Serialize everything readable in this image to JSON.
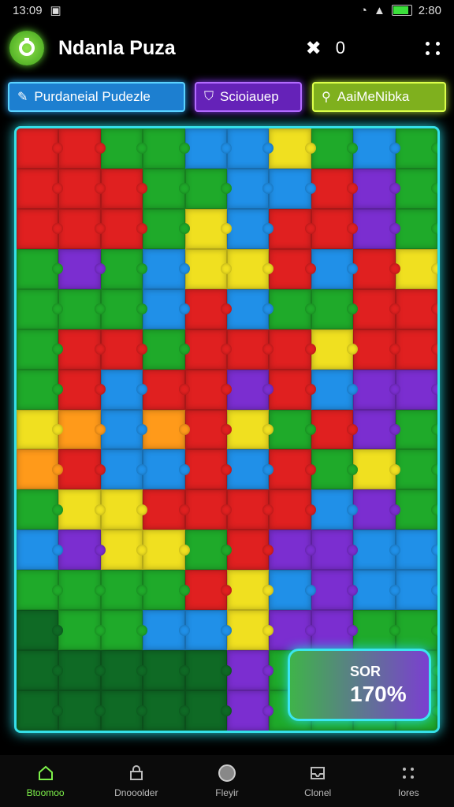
{
  "status": {
    "time": "13:09",
    "battery": "2:80",
    "battery_level": 0.8
  },
  "app": {
    "title": "Ndanla Puza",
    "close_label": "✖",
    "score_top": "0"
  },
  "tabs": [
    {
      "label": "Purdaneial Pudezle",
      "icon": "puzzle-icon"
    },
    {
      "label": "Scioiauep",
      "icon": "tag-icon"
    },
    {
      "label": "AaiMeNibka",
      "icon": "search-icon"
    }
  ],
  "score": {
    "label": "SOR",
    "value": "170%"
  },
  "nav": [
    {
      "label": "Btoomoo",
      "icon": "home-icon"
    },
    {
      "label": "Dnooolder",
      "icon": "lock-icon"
    },
    {
      "label": "Fleyir",
      "icon": "circle-icon"
    },
    {
      "label": "Clonel",
      "icon": "inbox-icon"
    },
    {
      "label": "Iores",
      "icon": "dots-icon"
    }
  ],
  "colors": {
    "red": "#e02020",
    "green": "#1faa2a",
    "blue": "#2090e8",
    "yellow": "#f0e020",
    "purple": "#7b2ed0",
    "orange": "#ff9a1a",
    "darkgreen": "#0f6a25"
  },
  "pieces": [
    "red",
    "red",
    "green",
    "green",
    "blue",
    "blue",
    "yellow",
    "green",
    "blue",
    "green",
    "red",
    "red",
    "red",
    "green",
    "green",
    "blue",
    "blue",
    "red",
    "purple",
    "green",
    "red",
    "red",
    "red",
    "green",
    "yellow",
    "blue",
    "red",
    "red",
    "purple",
    "green",
    "green",
    "purple",
    "green",
    "blue",
    "yellow",
    "yellow",
    "red",
    "blue",
    "red",
    "yellow",
    "green",
    "green",
    "green",
    "blue",
    "red",
    "blue",
    "green",
    "green",
    "red",
    "red",
    "green",
    "red",
    "red",
    "green",
    "red",
    "red",
    "red",
    "yellow",
    "red",
    "red",
    "green",
    "red",
    "blue",
    "red",
    "red",
    "purple",
    "red",
    "blue",
    "purple",
    "purple",
    "yellow",
    "orange",
    "blue",
    "orange",
    "red",
    "yellow",
    "green",
    "red",
    "purple",
    "green",
    "orange",
    "red",
    "blue",
    "blue",
    "red",
    "blue",
    "red",
    "green",
    "yellow",
    "green",
    "green",
    "yellow",
    "yellow",
    "red",
    "red",
    "red",
    "red",
    "blue",
    "purple",
    "green",
    "blue",
    "purple",
    "yellow",
    "yellow",
    "green",
    "red",
    "purple",
    "purple",
    "blue",
    "blue",
    "green",
    "green",
    "green",
    "green",
    "red",
    "yellow",
    "blue",
    "purple",
    "blue",
    "blue",
    "darkgreen",
    "green",
    "green",
    "blue",
    "blue",
    "yellow",
    "purple",
    "purple",
    "green",
    "green",
    "darkgreen",
    "darkgreen",
    "darkgreen",
    "darkgreen",
    "darkgreen",
    "purple",
    "green",
    "green",
    "green",
    "green",
    "darkgreen",
    "darkgreen",
    "darkgreen",
    "darkgreen",
    "darkgreen",
    "purple",
    "green",
    "green",
    "green",
    "green"
  ]
}
